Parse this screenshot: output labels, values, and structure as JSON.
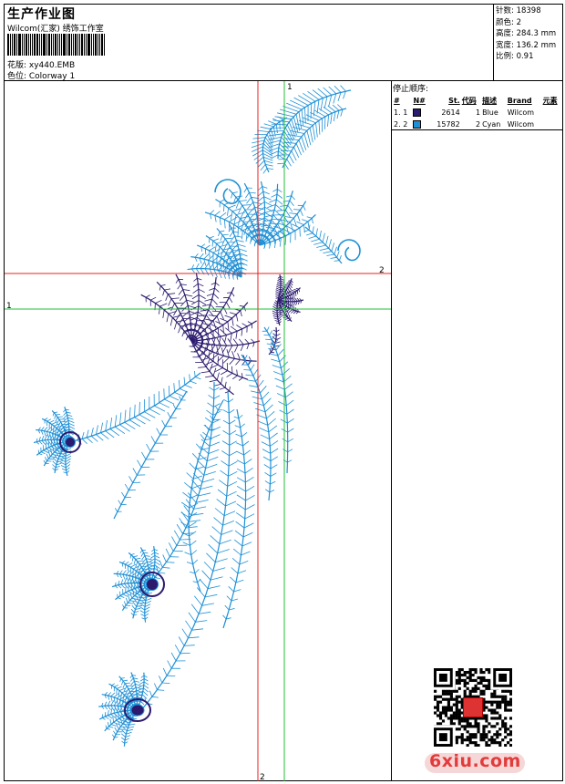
{
  "header": {
    "title": "生产作业图",
    "company": "Wilcom(汇家) 绣饰工作室",
    "design_label": "花版: xy440.EMB",
    "colorway_label": "色位:  Colorway 1"
  },
  "stats": {
    "stitches": "针数: 18398",
    "colors": "颜色: 2",
    "height": "高度: 284.3 mm",
    "width": "宽度: 136.2 mm",
    "scale": "比例: 0.91"
  },
  "stop_sequence": {
    "title": "停止顺序:",
    "headers": [
      "#",
      "N#",
      "St.",
      "代码",
      "描述",
      "Brand",
      "元素"
    ],
    "rows": [
      {
        "index": "1.",
        "n": "1",
        "stitches": "2614",
        "code": "1",
        "description": "Blue",
        "brand": "Wilcom",
        "color": "#2b1a6e"
      },
      {
        "index": "2.",
        "n": "2",
        "stitches": "15782",
        "code": "2",
        "description": "Cyan",
        "brand": "Wilcom",
        "color": "#1e90d6"
      }
    ]
  },
  "crosshairs": {
    "red_top_label": "2",
    "red_bottom_label": "2",
    "green_top_label": "1",
    "green_left_label": "1",
    "red_color": "#e82020",
    "green_color": "#22c13a"
  },
  "embroidery": {
    "blue_thread": "#2b1a6e",
    "cyan_thread": "#1e90d6"
  },
  "watermark": {
    "text": "6xiu.com",
    "color": "#e23b3b"
  },
  "icons": {
    "qr": "qr-code-icon",
    "seal": "red-seal-icon"
  }
}
